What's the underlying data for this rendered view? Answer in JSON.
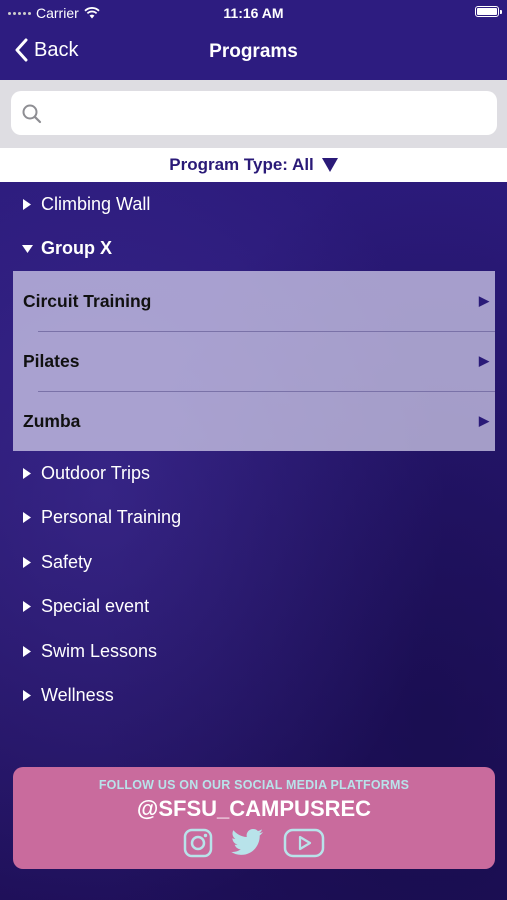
{
  "status_bar": {
    "carrier": "Carrier",
    "time": "11:16 AM",
    "icons": [
      "signal-dots-icon",
      "wifi-icon",
      "battery-icon"
    ]
  },
  "nav": {
    "back_label": "Back",
    "title": "Programs"
  },
  "search": {
    "placeholder": "",
    "value": ""
  },
  "filter": {
    "label": "Program Type: All",
    "icon": "triangle-down-icon"
  },
  "categories": [
    {
      "label": "Climbing Wall",
      "expanded": false
    },
    {
      "label": "Group X",
      "expanded": true,
      "items": [
        {
          "label": "Circuit Training"
        },
        {
          "label": "Pilates"
        },
        {
          "label": "Zumba"
        }
      ]
    },
    {
      "label": "Outdoor Trips",
      "expanded": false
    },
    {
      "label": "Personal Training",
      "expanded": false
    },
    {
      "label": "Safety",
      "expanded": false
    },
    {
      "label": "Special event",
      "expanded": false
    },
    {
      "label": "Swim Lessons",
      "expanded": false
    },
    {
      "label": "Wellness",
      "expanded": false
    }
  ],
  "banner": {
    "text": "FOLLOW US ON OUR SOCIAL MEDIA PLATFORMS",
    "handle": "@SFSU_CAMPUSREC",
    "icons": [
      "instagram-icon",
      "twitter-icon",
      "youtube-icon"
    ]
  },
  "colors": {
    "nav_bg": "#2d1c80",
    "accent_text": "#2a1a78",
    "banner_bg": "#c96b9d",
    "banner_text": "#b8e3ea"
  }
}
